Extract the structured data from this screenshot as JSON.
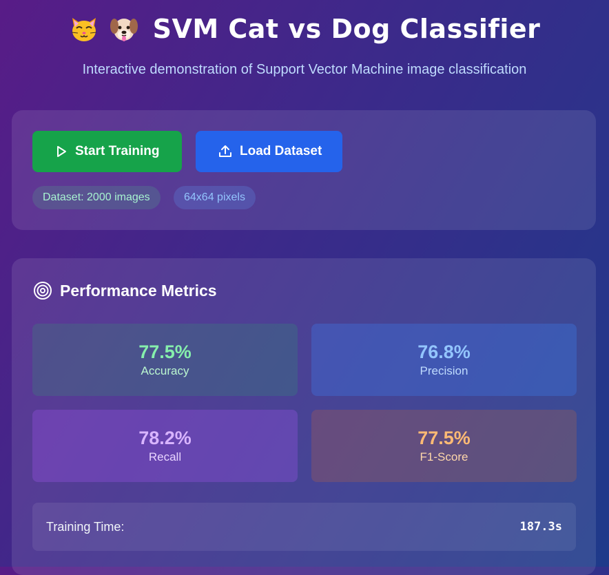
{
  "header": {
    "title": "SVM Cat vs Dog Classifier",
    "subtitle": "Interactive demonstration of Support Vector Machine image classification",
    "icons": [
      "cat-face-emoji",
      "dog-face-emoji"
    ]
  },
  "controls": {
    "start_training_label": "Start Training",
    "load_dataset_label": "Load Dataset",
    "dataset_info": "Dataset: 2000 images",
    "image_size": "64x64 pixels",
    "colors": {
      "train_button": "#16a34a",
      "load_button": "#2563eb"
    }
  },
  "metrics": {
    "title": "Performance Metrics",
    "accuracy": {
      "value": "77.5%",
      "label": "Accuracy",
      "color": "#86efac"
    },
    "precision": {
      "value": "76.8%",
      "label": "Precision",
      "color": "#93c5fd"
    },
    "recall": {
      "value": "78.2%",
      "label": "Recall",
      "color": "#d8b4fe"
    },
    "f1": {
      "value": "77.5%",
      "label": "F1-Score",
      "color": "#fdba74"
    },
    "training_time_label": "Training Time:",
    "training_time_value": "187.3s"
  }
}
